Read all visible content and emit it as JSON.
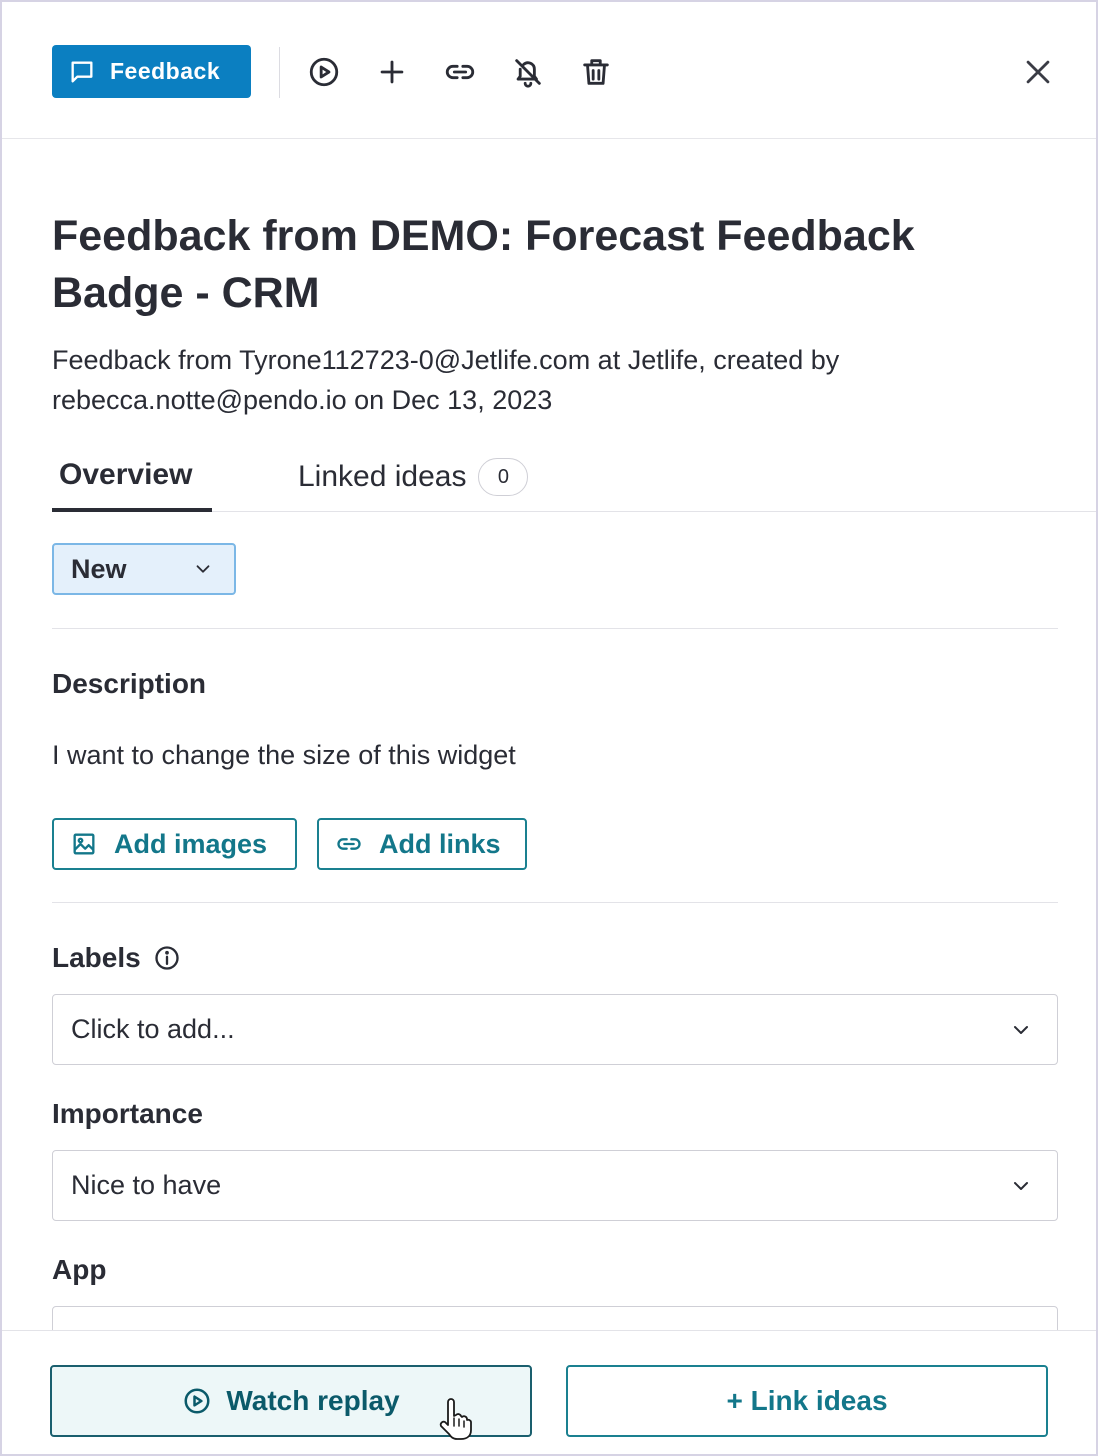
{
  "toolbar": {
    "feedback_label": "Feedback",
    "icons": [
      "play-circle-icon",
      "plus-icon",
      "link-icon",
      "bell-off-icon",
      "trash-icon",
      "close-icon"
    ]
  },
  "header": {
    "title": "Feedback from DEMO: Forecast Feedback Badge - CRM",
    "meta_line1": "Feedback from Tyrone112723-0@Jetlife.com at Jetlife, created by",
    "meta_line2": "rebecca.notte@pendo.io on Dec 13, 2023"
  },
  "tabs": [
    {
      "label": "Overview",
      "active": true
    },
    {
      "label": "Linked ideas",
      "count": "0"
    }
  ],
  "status": {
    "value": "New"
  },
  "description": {
    "heading": "Description",
    "text": "I want to change the size of this widget",
    "add_images_label": "Add images",
    "add_links_label": "Add links"
  },
  "labels": {
    "heading": "Labels",
    "placeholder": "Click to add..."
  },
  "importance": {
    "heading": "Importance",
    "value": "Nice to have"
  },
  "app": {
    "heading": "App",
    "value": ""
  },
  "footer": {
    "watch_replay_label": "Watch replay",
    "link_ideas_label": "+ Link ideas"
  },
  "colors": {
    "primary": "#0b7fc1",
    "teal": "#1a8090",
    "text": "#2a2c35",
    "status_bg": "#e4f0fb"
  }
}
